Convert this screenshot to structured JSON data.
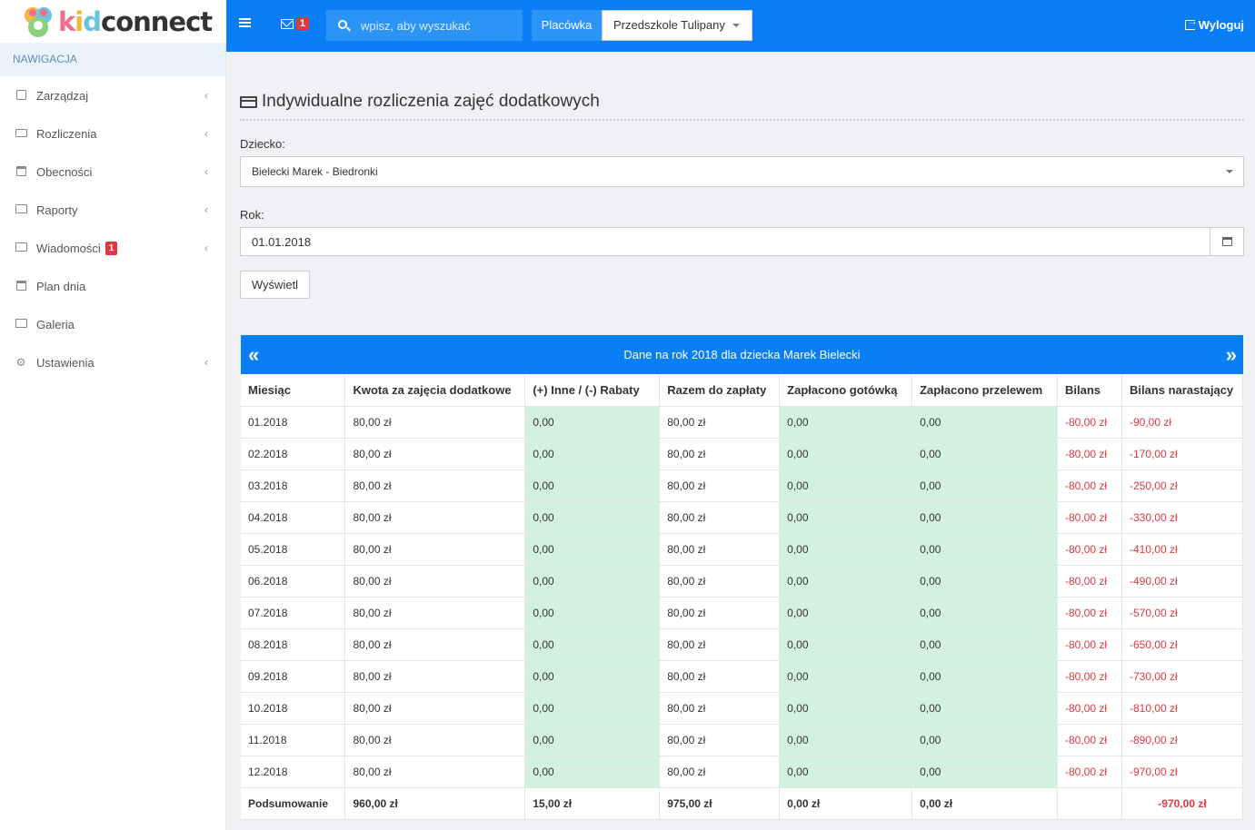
{
  "brand": {
    "k": "k",
    "i": "i",
    "d": "d",
    "rest": "connect"
  },
  "topbar": {
    "mail_count": "1",
    "search_placeholder": "wpisz, aby wyszukać",
    "facility_label": "Placówka",
    "facility_value": "Przedszkole Tulipany",
    "logout_label": "Wyloguj"
  },
  "sidebar": {
    "header": "Nawigacja",
    "items": [
      {
        "label": "Zarządzaj",
        "icon": "building-icon",
        "chevron": true
      },
      {
        "label": "Rozliczenia",
        "icon": "credit-card-icon",
        "chevron": true
      },
      {
        "label": "Obecności",
        "icon": "calendar-check-icon",
        "chevron": true
      },
      {
        "label": "Raporty",
        "icon": "id-card-icon",
        "chevron": true
      },
      {
        "label": "Wiadomości",
        "icon": "envelope-icon",
        "chevron": true,
        "badge": "1"
      },
      {
        "label": "Plan dnia",
        "icon": "calendar-icon",
        "chevron": false
      },
      {
        "label": "Galeria",
        "icon": "image-icon",
        "chevron": false
      },
      {
        "label": "Ustawienia",
        "icon": "gear-icon",
        "chevron": true
      }
    ]
  },
  "page": {
    "title": "Indywidualne rozliczenia zajęć dodatkowych",
    "child_label": "Dziecko:",
    "child_value": "Bielecki Marek - Biedronki",
    "year_label": "Rok:",
    "year_value": "01.01.2018",
    "show_button": "Wyświetl"
  },
  "table": {
    "caption": "Dane na rok 2018 dla dziecka Marek Bielecki",
    "headers": [
      "Miesiąc",
      "Kwota za zajęcia dodatkowe",
      "(+) Inne / (-) Rabaty",
      "Razem do zapłaty",
      "Zapłacono gotówką",
      "Zapłacono przelewem",
      "Bilans",
      "Bilans narastający"
    ],
    "rows": [
      [
        "01.2018",
        "80,00 zł",
        "0,00",
        "80,00 zł",
        "0,00",
        "0,00",
        "-80,00 zł",
        "-90,00 zł"
      ],
      [
        "02.2018",
        "80,00 zł",
        "0,00",
        "80,00 zł",
        "0,00",
        "0,00",
        "-80,00 zł",
        "-170,00 zł"
      ],
      [
        "03.2018",
        "80,00 zł",
        "0,00",
        "80,00 zł",
        "0,00",
        "0,00",
        "-80,00 zł",
        "-250,00 zł"
      ],
      [
        "04.2018",
        "80,00 zł",
        "0,00",
        "80,00 zł",
        "0,00",
        "0,00",
        "-80,00 zł",
        "-330,00 zł"
      ],
      [
        "05.2018",
        "80,00 zł",
        "0,00",
        "80,00 zł",
        "0,00",
        "0,00",
        "-80,00 zł",
        "-410,00 zł"
      ],
      [
        "06.2018",
        "80,00 zł",
        "0,00",
        "80,00 zł",
        "0,00",
        "0,00",
        "-80,00 zł",
        "-490,00 zł"
      ],
      [
        "07.2018",
        "80,00 zł",
        "0,00",
        "80,00 zł",
        "0,00",
        "0,00",
        "-80,00 zł",
        "-570,00 zł"
      ],
      [
        "08.2018",
        "80,00 zł",
        "0,00",
        "80,00 zł",
        "0,00",
        "0,00",
        "-80,00 zł",
        "-650,00 zł"
      ],
      [
        "09.2018",
        "80,00 zł",
        "0,00",
        "80,00 zł",
        "0,00",
        "0,00",
        "-80,00 zł",
        "-730,00 zł"
      ],
      [
        "10.2018",
        "80,00 zł",
        "0,00",
        "80,00 zł",
        "0,00",
        "0,00",
        "-80,00 zł",
        "-810,00 zł"
      ],
      [
        "11.2018",
        "80,00 zł",
        "0,00",
        "80,00 zł",
        "0,00",
        "0,00",
        "-80,00 zł",
        "-890,00 zł"
      ],
      [
        "12.2018",
        "80,00 zł",
        "0,00",
        "80,00 zł",
        "0,00",
        "0,00",
        "-80,00 zł",
        "-970,00 zł"
      ]
    ],
    "summary": [
      "Podsumowanie",
      "960,00 zł",
      "15,00 zł",
      "975,00 zł",
      "0,00 zł",
      "0,00 zł",
      "",
      "-970,00 zł"
    ]
  },
  "colors": {
    "primary": "#0a7ef5",
    "negative": "#e0383e",
    "highlight": "#d3f2dd"
  }
}
